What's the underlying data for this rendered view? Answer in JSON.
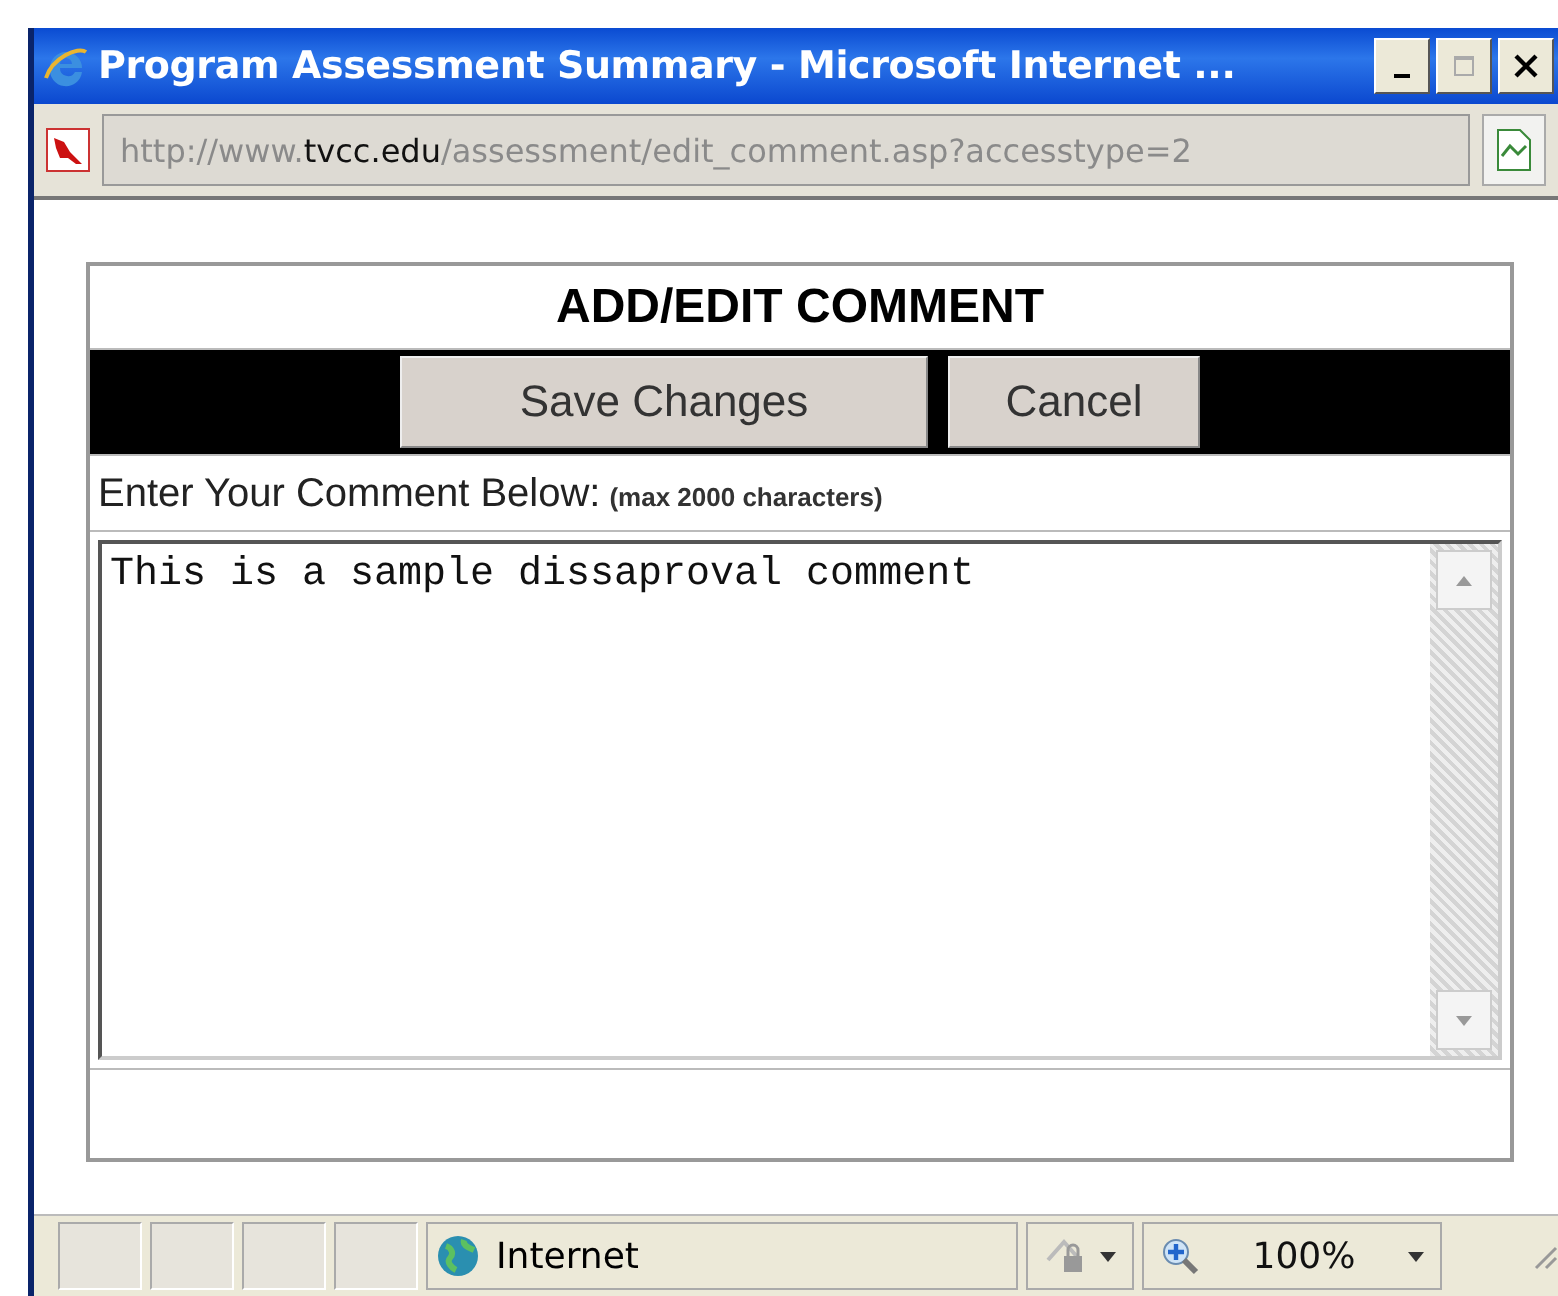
{
  "window": {
    "title": "Program Assessment Summary - Microsoft Internet ...",
    "maximize_disabled": true
  },
  "address_bar": {
    "url_prefix": "http://www.",
    "url_domain": "tvcc.edu",
    "url_path": "/assessment/edit_comment.asp?accesstype=2"
  },
  "form": {
    "heading": "ADD/EDIT COMMENT",
    "buttons": [
      "Save Changes",
      "Cancel"
    ],
    "label": "Enter Your Comment Below:",
    "hint": "(max 2000 characters)",
    "comment": "This is a sample dissaproval comment"
  },
  "status_bar": {
    "zone": "Internet",
    "zoom": "100%"
  }
}
